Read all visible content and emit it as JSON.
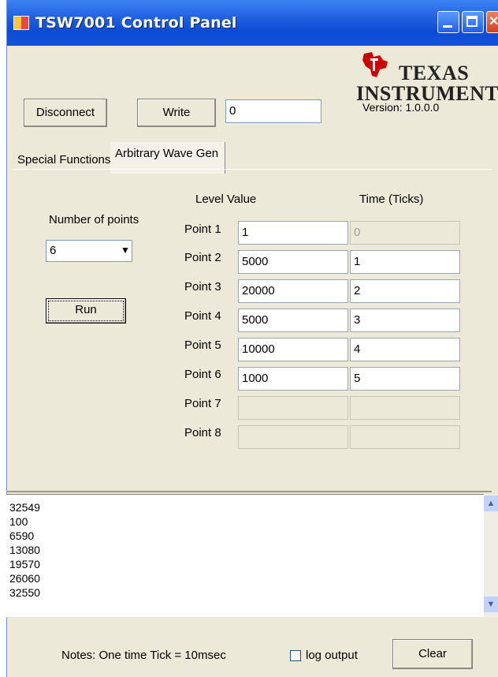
{
  "window": {
    "title": "TSW7001 Control Panel",
    "version": "Version: 1.0.0.0",
    "logo_line1": "TEXAS",
    "logo_line2": "INSTRUMENTS"
  },
  "toolbar": {
    "disconnect_label": "Disconnect",
    "write_label": "Write",
    "write_value": "0"
  },
  "tabs": [
    {
      "label": "Special Functions"
    },
    {
      "label": "Arbitrary Wave Gen"
    }
  ],
  "wavegen": {
    "num_points_label": "Number of points",
    "num_points_value": "6",
    "run_label": "Run",
    "col_level": "Level Value",
    "col_time": "Time (Ticks)",
    "points": [
      {
        "label": "Point 1",
        "level": "1",
        "time": "0"
      },
      {
        "label": "Point 2",
        "level": "5000",
        "time": "1"
      },
      {
        "label": "Point 3",
        "level": "20000",
        "time": "2"
      },
      {
        "label": "Point 4",
        "level": "5000",
        "time": "3"
      },
      {
        "label": "Point 5",
        "level": "10000",
        "time": "4"
      },
      {
        "label": "Point 6",
        "level": "1000",
        "time": "5"
      },
      {
        "label": "Point 7",
        "level": "",
        "time": ""
      },
      {
        "label": "Point 8",
        "level": "",
        "time": ""
      }
    ]
  },
  "log": {
    "lines": [
      "32549",
      "100",
      "6590",
      "13080",
      "19570",
      "26060",
      "32550"
    ]
  },
  "footer": {
    "notes": "Notes: One time Tick = 10msec",
    "log_output_label": "log output",
    "log_output_checked": false,
    "clear_label": "Clear"
  },
  "colors": {
    "titlebar": "#0a4bd4",
    "window_bg": "#ece9d8",
    "ti_red": "#cc0000"
  }
}
